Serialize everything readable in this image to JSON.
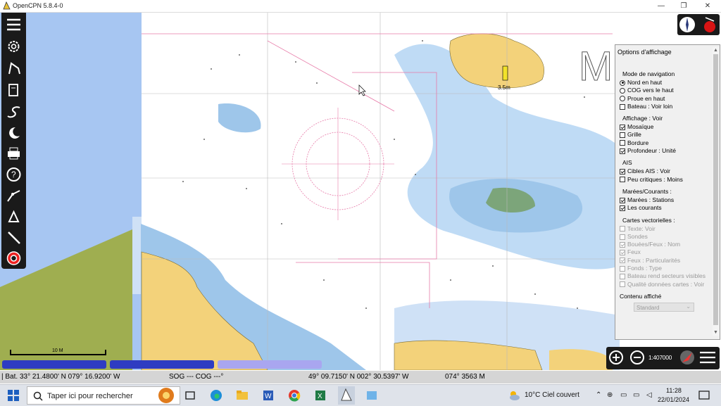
{
  "window": {
    "title": "OpenCPN 5.8.4-0",
    "controls": [
      "minimize-icon",
      "maximize-icon",
      "close-icon"
    ]
  },
  "toolbar": {
    "tools": [
      "menu-icon",
      "settings-icon",
      "route-icon",
      "track-icon",
      "curve-icon",
      "moon-icon",
      "print-icon",
      "help-icon",
      "measure-icon",
      "ais-icon",
      "ruler-icon",
      "lifebuoy-icon"
    ]
  },
  "chart": {
    "tide_label": "3.5m",
    "big_letter": "M",
    "scale_label": "10 M"
  },
  "options_panel": {
    "title": "Options d'affichage",
    "groups": [
      {
        "label": "Mode de navigation",
        "items": [
          {
            "type": "radio",
            "label": "Nord en haut",
            "checked": true,
            "enabled": true
          },
          {
            "type": "radio",
            "label": "COG vers le haut",
            "checked": false,
            "enabled": true
          },
          {
            "type": "radio",
            "label": "Proue en haut",
            "checked": false,
            "enabled": true
          },
          {
            "type": "check",
            "label": "Bateau : Voir loin",
            "checked": false,
            "enabled": true
          }
        ]
      },
      {
        "label": "Affichage : Voir",
        "items": [
          {
            "type": "check",
            "label": "Mosaïque",
            "checked": true,
            "enabled": true
          },
          {
            "type": "check",
            "label": "Grille",
            "checked": false,
            "enabled": true
          },
          {
            "type": "check",
            "label": "Bordure",
            "checked": false,
            "enabled": true
          },
          {
            "type": "check",
            "label": "Profondeur : Unité",
            "checked": true,
            "enabled": true
          }
        ]
      },
      {
        "label": "AIS",
        "items": [
          {
            "type": "check",
            "label": "Cibles AIS : Voir",
            "checked": true,
            "enabled": true
          },
          {
            "type": "check",
            "label": "Peu critiques : Moins",
            "checked": false,
            "enabled": true
          }
        ]
      },
      {
        "label": "Marées/Courants :",
        "items": [
          {
            "type": "check",
            "label": "Marées : Stations",
            "checked": true,
            "enabled": true
          },
          {
            "type": "check",
            "label": "Les courants",
            "checked": true,
            "enabled": true
          }
        ]
      },
      {
        "label": "Cartes vectorielles :",
        "items": [
          {
            "type": "check",
            "label": "Texte: Voir",
            "checked": false,
            "enabled": false
          },
          {
            "type": "check",
            "label": "Sondes",
            "checked": false,
            "enabled": false
          },
          {
            "type": "check",
            "label": "Bouées/Feux : Nom",
            "checked": true,
            "enabled": false
          },
          {
            "type": "check",
            "label": "Feux",
            "checked": true,
            "enabled": false
          },
          {
            "type": "check",
            "label": "Feux : Particularités",
            "checked": true,
            "enabled": false
          },
          {
            "type": "check",
            "label": "Fonds : Type",
            "checked": false,
            "enabled": false
          },
          {
            "type": "check",
            "label": "Bateau rend secteurs visibles",
            "checked": false,
            "enabled": false
          },
          {
            "type": "check",
            "label": "Qualité données cartes : Voir",
            "checked": false,
            "enabled": false
          }
        ]
      }
    ],
    "content_label": "Contenu affiché",
    "content_value": "Standard"
  },
  "zoom_bar": {
    "scale": "1:407000",
    "icons": [
      "zoom-in-icon",
      "zoom-out-icon",
      "compass-rose-icon",
      "menu-icon"
    ]
  },
  "piano_colors": [
    "#2e3cc2",
    "#2e3cc2",
    "#a9a6f0"
  ],
  "status_bar": {
    "boat": "| Bat. 33° 21.4800' N   079° 16.9200' W",
    "sog_cog": "SOG --- COG ---°",
    "cursor": "49° 09.7150' N   002° 30.5397' W",
    "bearing": "074°   3563 M"
  },
  "taskbar": {
    "search_placeholder": "Taper ici pour rechercher",
    "weather": "10°C  Ciel couvert",
    "time": "11:28",
    "date": "22/01/2024"
  }
}
